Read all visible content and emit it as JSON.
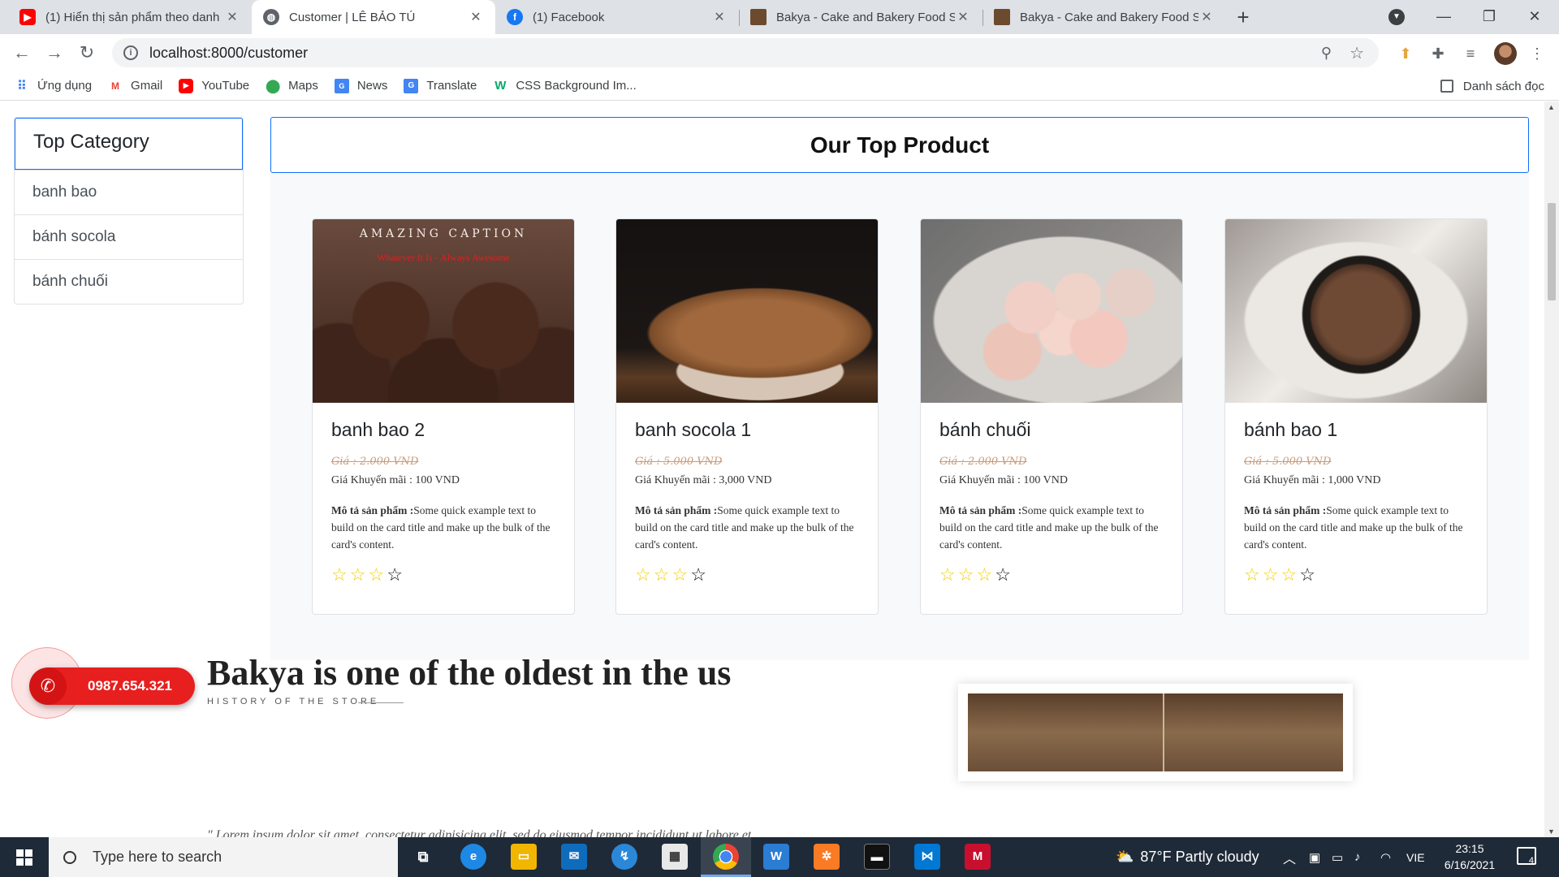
{
  "browser": {
    "tabs": [
      {
        "title": "(1) Hiển thị sản phẩm theo danh",
        "icon": "youtube-icon"
      },
      {
        "title": "Customer | LÊ BẢO TÚ",
        "icon": "globe-icon"
      },
      {
        "title": "(1) Facebook",
        "icon": "facebook-icon"
      },
      {
        "title": "Bakya - Cake and Bakery Food St",
        "icon": "bakya-icon"
      },
      {
        "title": "Bakya - Cake and Bakery Food St",
        "icon": "bakya-icon"
      }
    ],
    "url": "localhost:8000/customer",
    "bookmarks": [
      {
        "label": "Ứng dụng",
        "icon": "apps-grid-icon"
      },
      {
        "label": "Gmail",
        "icon": "gmail-icon"
      },
      {
        "label": "YouTube",
        "icon": "youtube-icon"
      },
      {
        "label": "Maps",
        "icon": "maps-icon"
      },
      {
        "label": "News",
        "icon": "news-icon"
      },
      {
        "label": "Translate",
        "icon": "translate-icon"
      },
      {
        "label": "CSS Background Im...",
        "icon": "w3schools-icon"
      }
    ],
    "reading_list": "Danh sách đọc"
  },
  "sidebar": {
    "title": "Top Category",
    "items": [
      "banh bao",
      "bánh socola",
      "bánh chuối"
    ]
  },
  "products": {
    "heading": "Our Top Product",
    "price_label": "Giá :",
    "promo_label": "Giá Khuyến mãi :",
    "desc_label": "Mô tả sản phẩm :",
    "items": [
      {
        "name": "banh bao 2",
        "price": "Giá : 2.000 VND",
        "promo": "Giá Khuyến mãi : 100 VND",
        "desc": "Some quick example text to build on the card title and make up the bulk of the card's content.",
        "rating": 3,
        "max_rating": 4,
        "caption_title": "AMAZING CAPTION",
        "caption_sub": "Whatever It Is - Always Awesome"
      },
      {
        "name": "banh socola 1",
        "price": "Giá : 5.000 VND",
        "promo": "Giá Khuyến mãi : 3,000 VND",
        "desc": "Some quick example text to build on the card title and make up the bulk of the card's content.",
        "rating": 3,
        "max_rating": 4
      },
      {
        "name": "bánh chuối",
        "price": "Giá : 2.000 VND",
        "promo": "Giá Khuyến mãi : 100 VND",
        "desc": "Some quick example text to build on the card title and make up the bulk of the card's content.",
        "rating": 3,
        "max_rating": 4
      },
      {
        "name": "bánh bao 1",
        "price": "Giá : 5.000 VND",
        "promo": "Giá Khuyến mãi : 1,000 VND",
        "desc": "Some quick example text to build on the card title and make up the bulk of the card's content.",
        "rating": 3,
        "max_rating": 4
      }
    ]
  },
  "about": {
    "title": "Bakya is one of the oldest in the us",
    "subtitle": "HISTORY OF THE STORE",
    "lorem": "\" Lorem ipsum dolor sit amet, consectetur adipisicing elit, sed do eiusmod tempor incididunt ut labore et"
  },
  "phone_cta": {
    "number": "0987.654.321"
  },
  "taskbar": {
    "search_placeholder": "Type here to search",
    "weather": "87°F  Partly cloudy",
    "language": "VIE",
    "time": "23:15",
    "date": "6/16/2021",
    "notifications": "4"
  },
  "colors": {
    "accent": "#0d6efd",
    "cta_red": "#e71f1f",
    "star": "#f0d000"
  }
}
